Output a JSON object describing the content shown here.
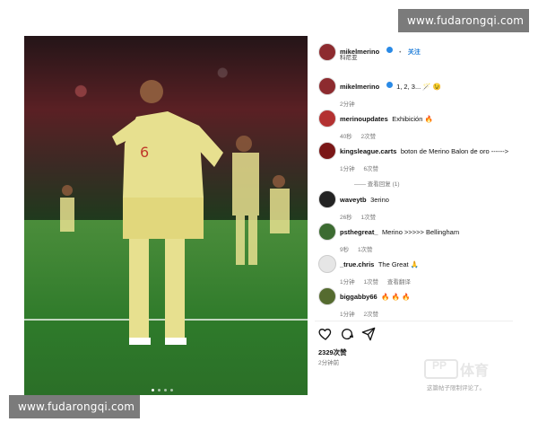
{
  "watermarks": {
    "top": "www.fudarongqi.com",
    "bottom": "www.fudarongqi.com"
  },
  "header": {
    "username": "mikelmerino",
    "follow_label": "关注",
    "subtitle": "科尼亚"
  },
  "caption": {
    "username": "mikelmerino",
    "text": "1, 2, 3... 🪄 😉",
    "time": "2分钟"
  },
  "comments": [
    {
      "username": "merinoupdates",
      "text": "Exhibición 🔥",
      "time": "40秒",
      "likes": "2次赞",
      "reply": ""
    },
    {
      "username": "kingsleague.carts",
      "text": "boton de Merino Balon de oro ------>",
      "time": "1分钟",
      "likes": "6次赞",
      "reply": "",
      "view_replies": "—— 查看回复 (1)"
    },
    {
      "username": "waveytb",
      "text": "3erino",
      "time": "26秒",
      "likes": "1次赞",
      "reply": ""
    },
    {
      "username": "psthegreat_",
      "text": "Merino >>>>> Bellingham",
      "time": "9秒",
      "likes": "1次赞",
      "reply": ""
    },
    {
      "username": "_true.chris",
      "text": "The Great 🙏",
      "time": "1分钟",
      "likes": "1次赞",
      "reply": "查看翻译"
    },
    {
      "username": "biggabby66",
      "text": "🔥 🔥 🔥",
      "time": "1分钟",
      "likes": "2次赞",
      "reply": ""
    }
  ],
  "actions": {
    "like_icon": "heart-icon",
    "comment_icon": "comment-icon",
    "share_icon": "send-icon"
  },
  "likes": {
    "count": "2329次赞",
    "time": "2分钟前"
  },
  "brand": {
    "pp": "PP",
    "cn": "体育"
  },
  "comment_placeholder": "这篇帖子限制评论了。",
  "colors": {
    "verified": "#2a8ae6",
    "follow": "#1c7bd8",
    "watermark_bg": "#7b7b7b"
  }
}
